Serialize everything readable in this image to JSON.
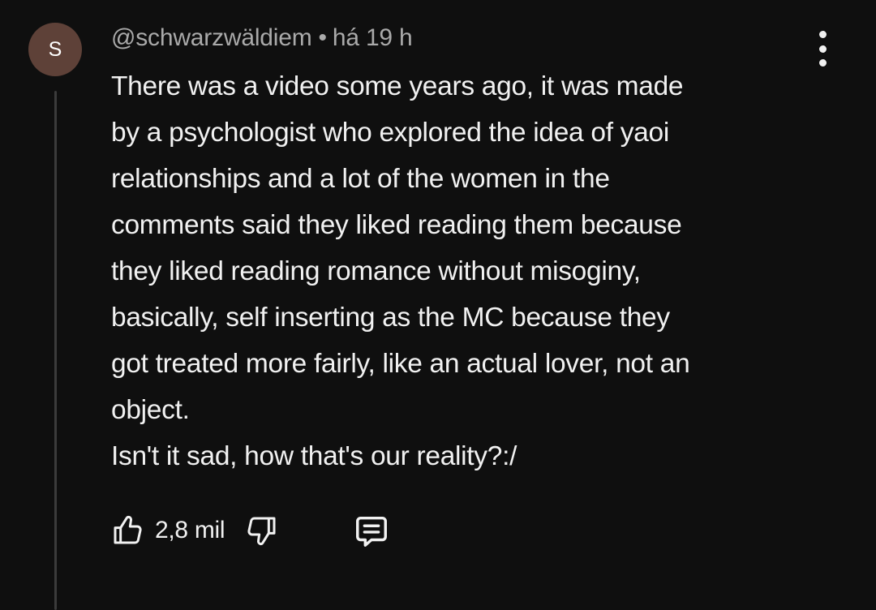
{
  "comment": {
    "avatar_letter": "S",
    "avatar_color": "#5e4138",
    "author": "@schwarzwäldiem",
    "separator": "•",
    "time": "há 19 h",
    "lines": [
      "There was a video some years ago, it was made",
      "by a psychologist who explored the idea of yaoi",
      "relationships and a lot of the women in the",
      "comments said they liked reading them because",
      "they liked reading romance without misoginy,",
      "basically, self inserting as the MC because they",
      "got treated more fairly, like an actual lover, not an",
      "object.",
      "Isn't it sad, how that's our reality?:/"
    ],
    "like_count": "2,8 mil"
  },
  "icons": {
    "more": "more-vertical-icon",
    "like": "thumbs-up-icon",
    "dislike": "thumbs-down-icon",
    "reply": "comment-reply-icon"
  },
  "colors": {
    "background": "#0f0f0f",
    "text": "#f1f1f1",
    "meta_text": "#aaaaaa",
    "thread_line": "#3b3b3b"
  }
}
